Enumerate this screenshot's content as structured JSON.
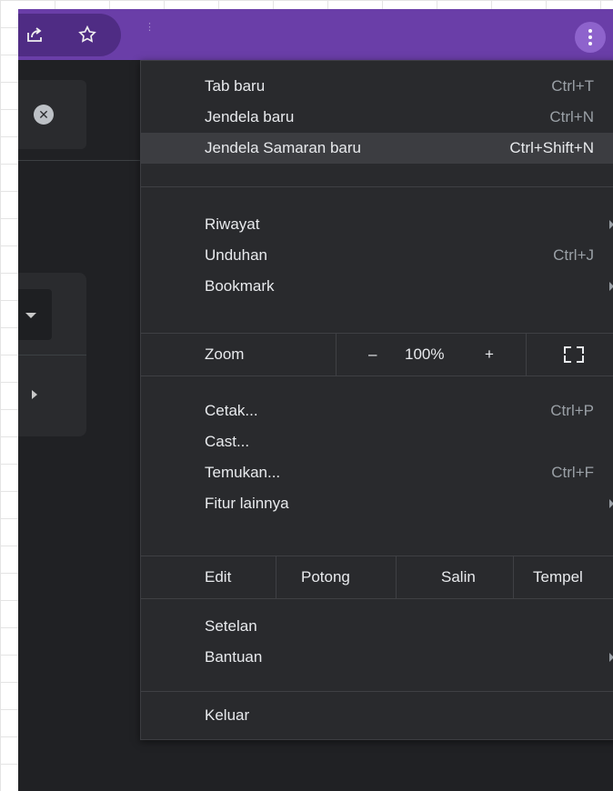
{
  "toolbar": {
    "share_icon": "share-icon",
    "bookmark_icon": "star-icon",
    "menu_icon": "kebab-menu-icon",
    "accent": "#6a3ea8"
  },
  "menu": {
    "group1": [
      {
        "label": "Tab baru",
        "shortcut": "Ctrl+T"
      },
      {
        "label": "Jendela baru",
        "shortcut": "Ctrl+N"
      },
      {
        "label": "Jendela Samaran baru",
        "shortcut": "Ctrl+Shift+N"
      }
    ],
    "group2": [
      {
        "label": "Riwayat"
      },
      {
        "label": "Unduhan",
        "shortcut": "Ctrl+J"
      },
      {
        "label": "Bookmark"
      }
    ],
    "zoom": {
      "label": "Zoom",
      "minus": "–",
      "level": "100%",
      "plus": "+"
    },
    "group3": [
      {
        "label": "Cetak...",
        "shortcut": "Ctrl+P"
      },
      {
        "label": "Cast..."
      },
      {
        "label": "Temukan...",
        "shortcut": "Ctrl+F"
      },
      {
        "label": "Fitur lainnya"
      }
    ],
    "edit": {
      "label": "Edit",
      "cut": "Potong",
      "copy": "Salin",
      "paste": "Tempel"
    },
    "group4": [
      {
        "label": "Setelan"
      },
      {
        "label": "Bantuan"
      }
    ],
    "group5": [
      {
        "label": "Keluar"
      }
    ]
  }
}
